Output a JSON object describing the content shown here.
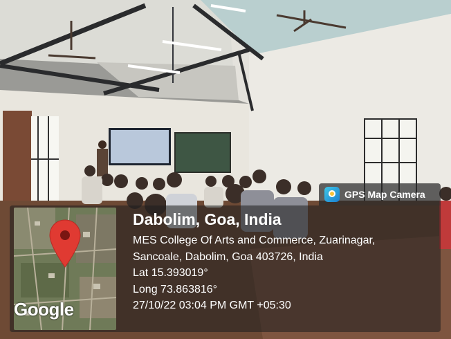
{
  "overlay": {
    "app_name": "GPS Map Camera",
    "location_title": "Dabolim, Goa, India",
    "address_line1": "MES College Of Arts and Commerce, Zuarinagar,",
    "address_line2": "Sancoale, Dabolim, Goa 403726, India",
    "latitude": "Lat 15.393019°",
    "longitude": "Long 73.863816°",
    "datetime": "27/10/22 03:04 PM GMT +05:30",
    "map_brand": "Google"
  },
  "colors": {
    "pin": "#e03a32",
    "panel_bg": "rgba(30,30,30,0.55)",
    "badge_bg": "rgba(40,40,40,0.72)"
  }
}
